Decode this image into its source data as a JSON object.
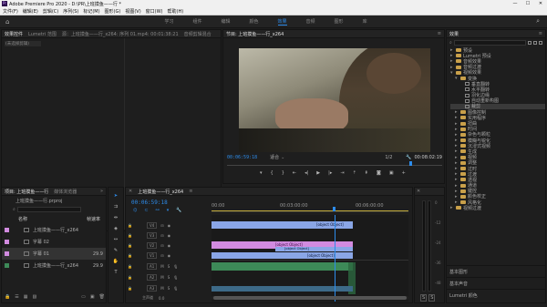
{
  "window": {
    "title": "Adobe Premiere Pro 2020 - D:\\PR\\上班摸鱼——行 *"
  },
  "menu": [
    "文件(F)",
    "编辑(E)",
    "剪辑(C)",
    "序列(S)",
    "标记(M)",
    "图形(G)",
    "视图(V)",
    "窗口(W)",
    "帮助(H)"
  ],
  "workspaces": {
    "items": [
      "学习",
      "组件",
      "编辑",
      "颜色",
      "效果",
      "音频",
      "图形",
      "库"
    ],
    "active": "效果"
  },
  "source_panel": {
    "tabs": [
      "效果控件",
      "Lumetri 范围",
      "源：上班摸鱼——行_x264: 序列 01.mp4: 00:01:38:21",
      "音频剪辑混合"
    ],
    "empty_text": "(未选择剪辑)"
  },
  "program_monitor": {
    "title": "节目: 上班摸鱼——行_x264",
    "timecode": "00:06:59:18",
    "fit": "适合",
    "zoom": "1/2",
    "duration": "00:08:02:19"
  },
  "project_panel": {
    "tabs": [
      "项目: 上班摸鱼——行",
      "媒体浏览器"
    ],
    "project_file": "上班摸鱼——行.prproj",
    "search_placeholder": "",
    "col_name": "名称",
    "col_rate": "帧速率",
    "items": [
      {
        "name": "上班摸鱼——行_x264",
        "rate": ""
      },
      {
        "name": "字幕 02",
        "rate": ""
      },
      {
        "name": "字幕 01",
        "rate": "29.9"
      },
      {
        "name": "上班摸鱼——行_x264",
        "rate": "29.9"
      }
    ]
  },
  "timeline": {
    "tab": "上班摸鱼——行_x264",
    "timecode": "00:06:59:18",
    "ruler": [
      "00:00",
      "00:03:00:00",
      "00:06:00:00"
    ],
    "video_tracks": [
      "V4",
      "V3",
      "V2",
      "V1"
    ],
    "audio_tracks": [
      "A1",
      "A2",
      "A3"
    ],
    "master": "主声道",
    "master_value": "0.0",
    "clips": [
      {
        "label": "fx 上班摸鱼——行.mp4 [V]"
      },
      {
        "label": "fx 上班摸鱼——行_x264 [V]"
      },
      {
        "label": "fx 上班摸鱼——行_x264 源 [V]"
      },
      {
        "label": "fx 上班摸鱼——行_x264 [V]"
      }
    ],
    "db_labels": [
      "0",
      "-12",
      "-24",
      "-36",
      "-48"
    ]
  },
  "effects_panel": {
    "tab": "效果",
    "root_items": [
      {
        "label": "预设",
        "level": 0
      },
      {
        "label": "Lumetri 预设",
        "level": 0
      },
      {
        "label": "音频效果",
        "level": 0
      },
      {
        "label": "音频过渡",
        "level": 0
      },
      {
        "label": "视频效果",
        "level": 0
      }
    ],
    "video_effect_items": [
      {
        "label": "变换",
        "level": 1,
        "open": true
      },
      {
        "label": "垂直翻转",
        "level": 2
      },
      {
        "label": "水平翻转",
        "level": 2
      },
      {
        "label": "羽化边缘",
        "level": 2
      },
      {
        "label": "自动重新构图",
        "level": 2
      },
      {
        "label": "裁剪",
        "level": 2,
        "selected": true
      },
      {
        "label": "图像控制",
        "level": 1
      },
      {
        "label": "实用程序",
        "level": 1
      },
      {
        "label": "扭曲",
        "level": 1
      },
      {
        "label": "时间",
        "level": 1
      },
      {
        "label": "杂色与颗粒",
        "level": 1
      },
      {
        "label": "模糊与锐化",
        "level": 1
      },
      {
        "label": "沉浸式视频",
        "level": 1
      },
      {
        "label": "生成",
        "level": 1
      },
      {
        "label": "视频",
        "level": 1
      },
      {
        "label": "调整",
        "level": 1
      },
      {
        "label": "过时",
        "level": 1
      },
      {
        "label": "过渡",
        "level": 1
      },
      {
        "label": "透视",
        "level": 1
      },
      {
        "label": "通道",
        "level": 1
      },
      {
        "label": "键控",
        "level": 1
      },
      {
        "label": "颜色校正",
        "level": 1
      },
      {
        "label": "风格化",
        "level": 1
      },
      {
        "label": "视频过渡",
        "level": 0
      }
    ],
    "bottom": [
      "基本图形",
      "基本声音",
      "Lumetri 颜色"
    ]
  },
  "colors": {
    "accent": "#2d8ceb",
    "video_clip": "#8aa6e6",
    "title_clip": "#d28be0",
    "audio_clip": "#3d8a58",
    "folder": "#c9a04a"
  }
}
